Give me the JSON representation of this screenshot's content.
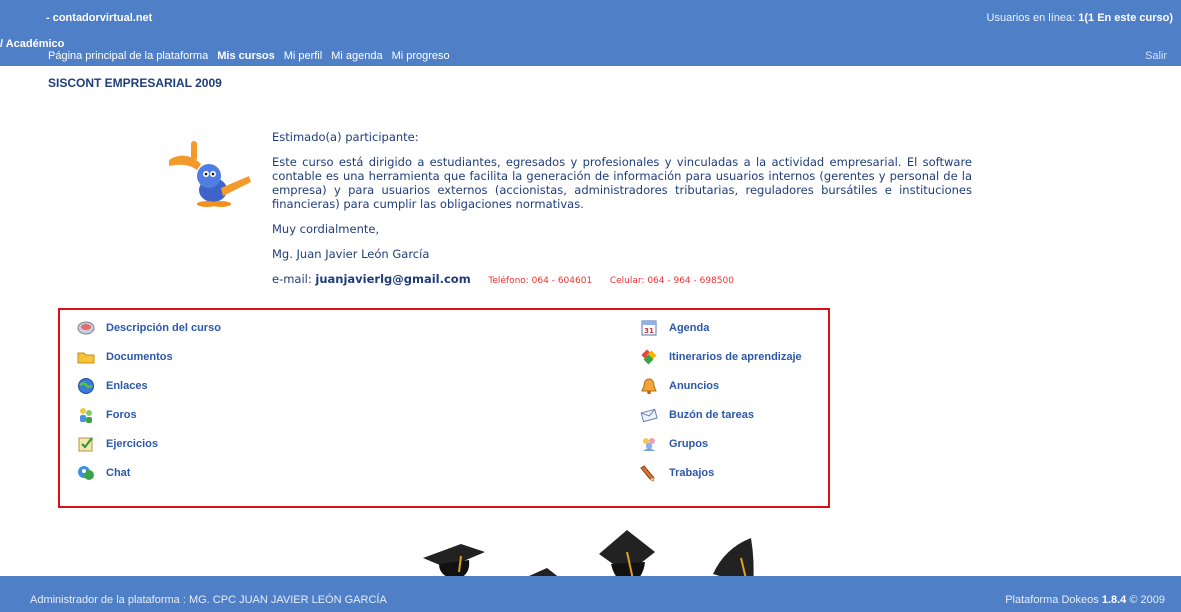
{
  "header": {
    "site": "- contadorvirtual.net",
    "online_prefix": "Usuarios en línea: ",
    "online_value": "1(1 En este curso)",
    "breadcrumb": "/ Académico",
    "nav": [
      "Página principal de la plataforma",
      "Mis cursos",
      "Mi perfil",
      "Mi agenda",
      "Mi progreso"
    ],
    "logout": "Salir"
  },
  "course_title": "SISCONT EMPRESARIAL 2009",
  "welcome": {
    "greeting": "Estimado(a) participante:",
    "body": "Este curso está dirigido a estudiantes, egresados y profesionales y vinculadas a la actividad empresarial. El software contable es una herramienta que facilita la generación de información para usuarios internos (gerentes y personal de la empresa) y para usuarios externos (accionistas, administradores tributarias, reguladores bursátiles e instituciones financieras) para cumplir las obligaciones normativas.",
    "closing": "Muy cordialmente,",
    "signature": "Mg. Juan Javier León García",
    "email_label": "e-mail:",
    "email": "juanjavierlg@gmail.com",
    "phone": "Teléfono: 064 - 604601",
    "mobile": "Celular: 064 - 964 - 698500"
  },
  "tools": {
    "left": [
      {
        "label": "Descripción del curso",
        "icon": "description-icon"
      },
      {
        "label": "Documentos",
        "icon": "folder-icon"
      },
      {
        "label": "Enlaces",
        "icon": "globe-icon"
      },
      {
        "label": "Foros",
        "icon": "forum-icon"
      },
      {
        "label": "Ejercicios",
        "icon": "exercise-icon"
      },
      {
        "label": "Chat",
        "icon": "chat-icon"
      }
    ],
    "right": [
      {
        "label": "Agenda",
        "icon": "calendar-icon"
      },
      {
        "label": "Itinerarios de aprendizaje",
        "icon": "learning-path-icon"
      },
      {
        "label": "Anuncios",
        "icon": "bell-icon"
      },
      {
        "label": "Buzón de tareas",
        "icon": "mailbox-icon"
      },
      {
        "label": "Grupos",
        "icon": "groups-icon"
      },
      {
        "label": "Trabajos",
        "icon": "pencil-icon"
      }
    ]
  },
  "footer": {
    "admin": "Administrador de la plataforma : MG. CPC JUAN JAVIER LEÓN GARCÍA",
    "platform_prefix": "Plataforma Dokeos ",
    "platform_version": "1.8.4",
    "platform_suffix": " © 2009"
  }
}
